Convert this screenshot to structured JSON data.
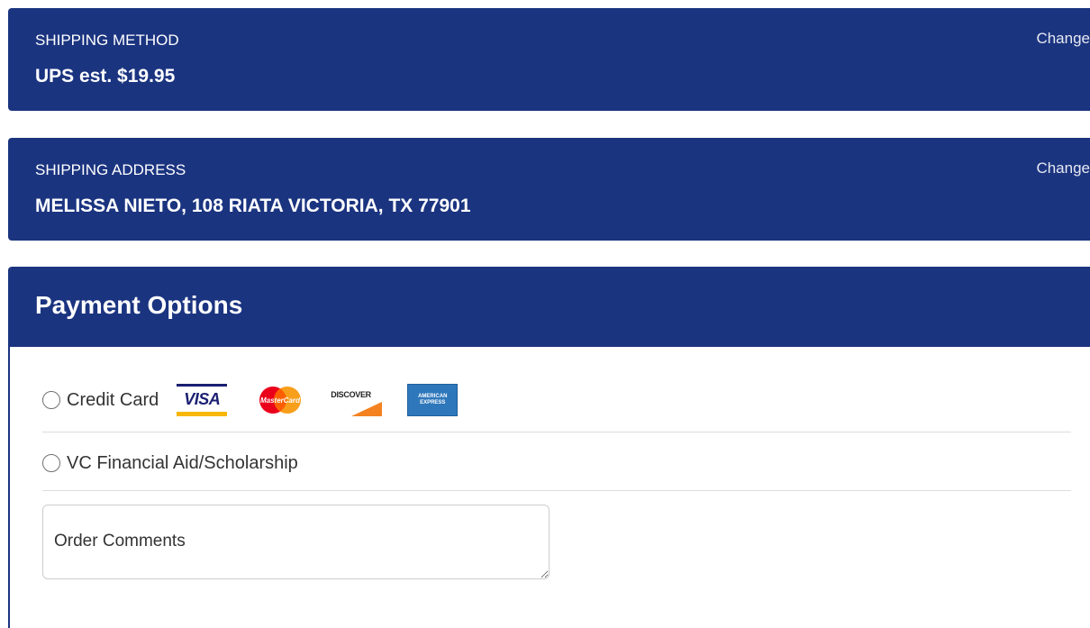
{
  "shipping_method": {
    "label": "SHIPPING METHOD",
    "value": "UPS est. $19.95",
    "change_label": "Change"
  },
  "shipping_address": {
    "label": "SHIPPING ADDRESS",
    "value": "MELISSA NIETO, 108 RIATA VICTORIA, TX 77901",
    "change_label": "Change"
  },
  "payment": {
    "title": "Payment Options",
    "options": [
      {
        "label": "Credit Card",
        "selected": false
      },
      {
        "label": "VC Financial Aid/Scholarship",
        "selected": false
      }
    ],
    "card_logos": {
      "visa": "VISA",
      "mastercard": "MasterCard",
      "discover": "DISCOVER",
      "amex_line1": "AMERICAN",
      "amex_line2": "EXPRESS"
    },
    "comments_placeholder": "Order Comments"
  },
  "colors": {
    "panel_blue": "#1b3480",
    "text_dark": "#333333",
    "divider": "#dddddd"
  }
}
